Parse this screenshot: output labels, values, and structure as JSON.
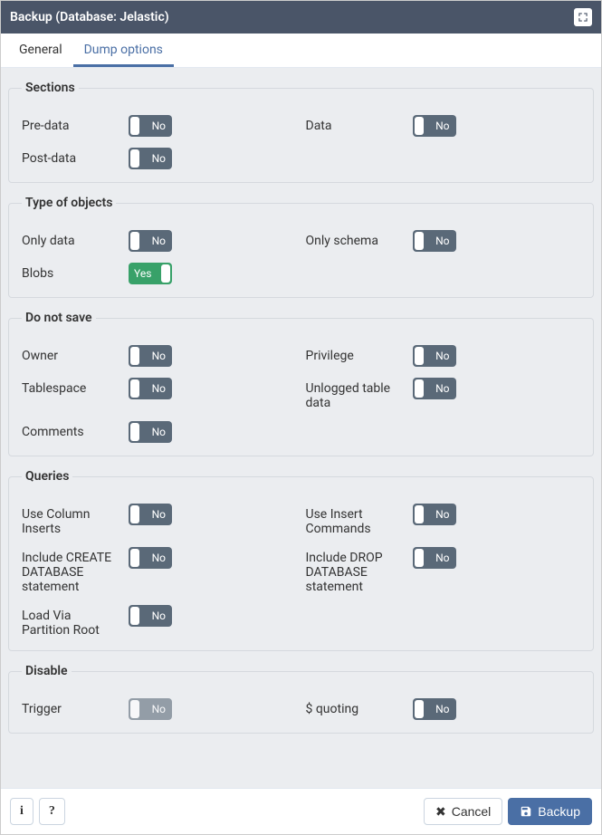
{
  "header": {
    "title": "Backup (Database: Jelastic)"
  },
  "tabs": {
    "general": "General",
    "dump_options": "Dump options"
  },
  "toggle_labels": {
    "yes": "Yes",
    "no": "No"
  },
  "sections": {
    "sections": {
      "legend": "Sections",
      "pre_data": "Pre-data",
      "data": "Data",
      "post_data": "Post-data"
    },
    "type_of_objects": {
      "legend": "Type of objects",
      "only_data": "Only data",
      "only_schema": "Only schema",
      "blobs": "Blobs"
    },
    "do_not_save": {
      "legend": "Do not save",
      "owner": "Owner",
      "privilege": "Privilege",
      "tablespace": "Tablespace",
      "unlogged": "Unlogged table data",
      "comments": "Comments"
    },
    "queries": {
      "legend": "Queries",
      "use_column_inserts": "Use Column Inserts",
      "use_insert_commands": "Use Insert Commands",
      "include_create": "Include CREATE DATABASE statement",
      "include_drop": "Include DROP DATABASE statement",
      "load_via_partition_root": "Load Via Partition Root"
    },
    "disable": {
      "legend": "Disable",
      "trigger": "Trigger",
      "dollar_quoting": "$ quoting"
    }
  },
  "footer": {
    "info": "i",
    "help": "?",
    "cancel": "Cancel",
    "backup": "Backup"
  }
}
